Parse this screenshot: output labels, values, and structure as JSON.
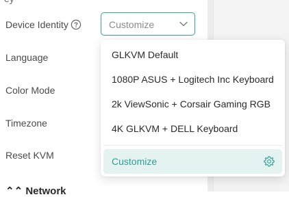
{
  "settings": {
    "top_partial": "ey",
    "device_identity_label": "Device Identity",
    "language_label": "Language",
    "color_mode_label": "Color Mode",
    "timezone_label": "Timezone",
    "reset_label": "Reset KVM",
    "network_partial": "Network"
  },
  "select": {
    "value": "Customize"
  },
  "dropdown": {
    "options": [
      "GLKVM Default",
      "1080P ASUS + Logitech Inc Keyboard",
      "2k ViewSonic + Corsair Gaming RGB",
      "4K GLKVM + DELL Keyboard"
    ],
    "selected": "Customize"
  },
  "colors": {
    "accent": "#33a79d",
    "selected_bg": "#e4f3f1"
  },
  "icons": {
    "help": "help-circle-icon",
    "chevron": "chevron-down-icon",
    "gear": "gear-icon",
    "collapse": "chevron-up-double-icon"
  }
}
